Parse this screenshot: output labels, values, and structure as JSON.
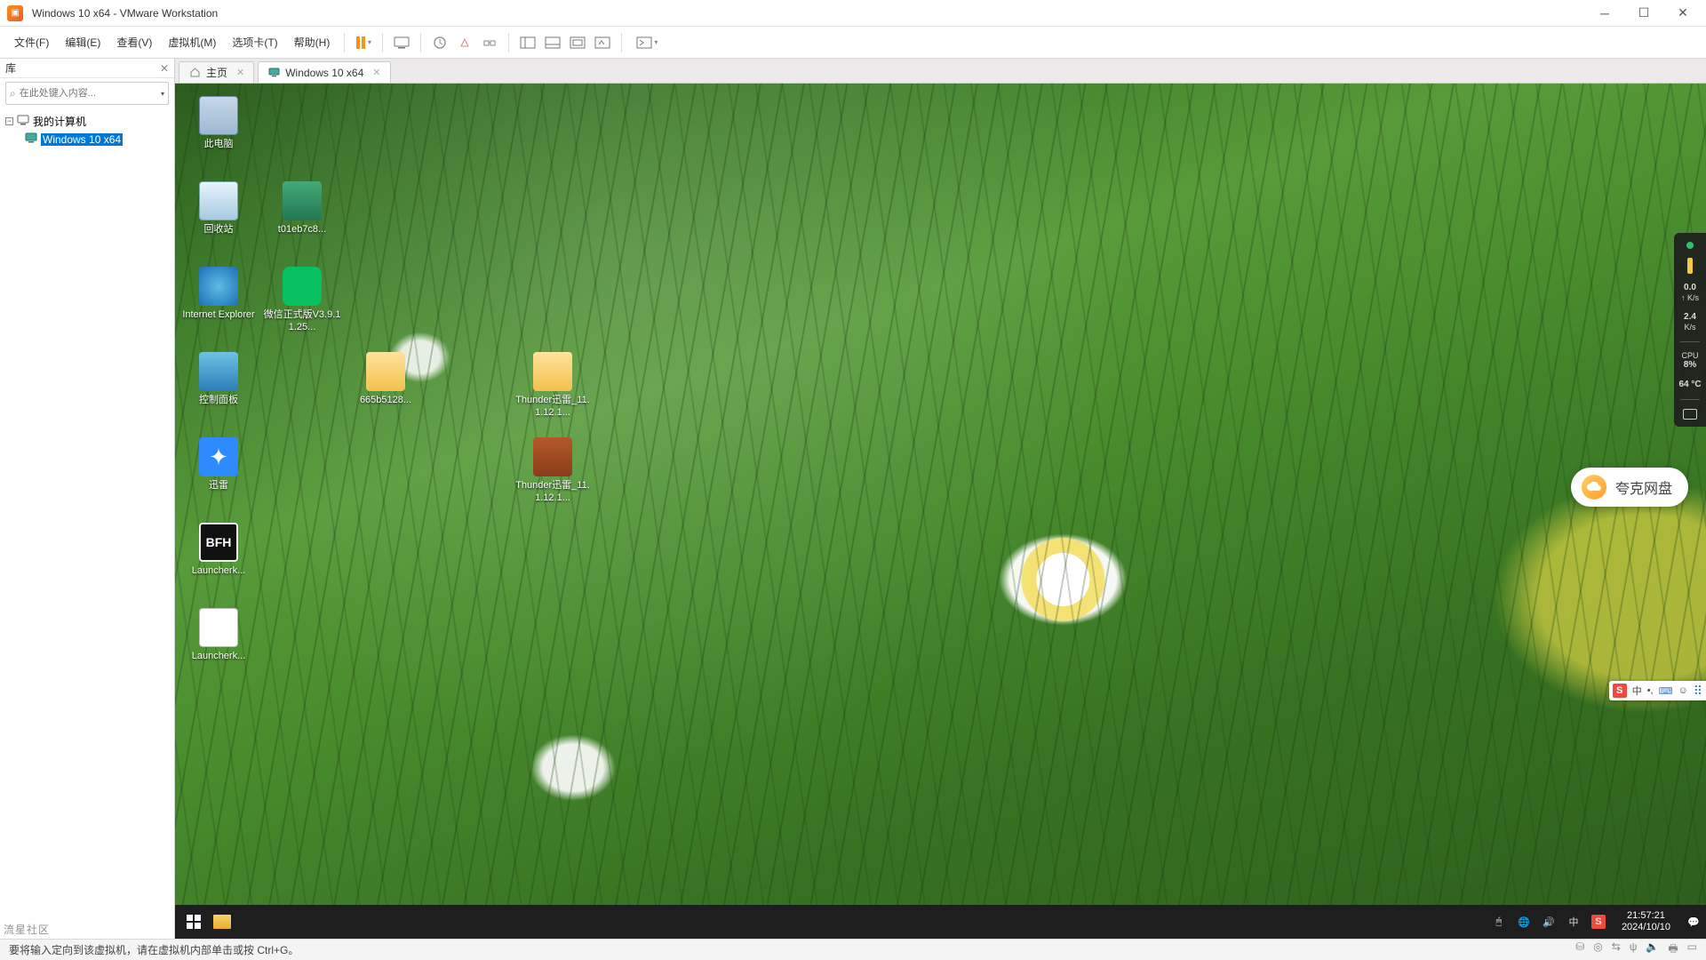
{
  "window": {
    "title": "Windows 10 x64 - VMware Workstation"
  },
  "menu": {
    "file": "文件(F)",
    "edit": "编辑(E)",
    "view": "查看(V)",
    "vm": "虚拟机(M)",
    "tabs": "选项卡(T)",
    "help": "帮助(H)"
  },
  "library": {
    "title": "库",
    "search_placeholder": "在此处键入内容...",
    "root": "我的计算机",
    "vm": "Windows 10 x64"
  },
  "tabs": {
    "home": "主页",
    "vm": "Windows 10 x64"
  },
  "desktop": {
    "this_pc": "此电脑",
    "recycle": "回收站",
    "thumb": "t01eb7c8...",
    "ie": "Internet Explorer",
    "wechat": "微信正式版V3.9.11.25...",
    "ctrl_panel": "控制面板",
    "folder665": "665b5128...",
    "thunder_inst": "Thunder迅雷_11.1.12.1...",
    "xunlei": "迅雷",
    "thunder_rar": "Thunder迅雷_11.1.12.1...",
    "bfh": "Launcherk...",
    "launcherk": "Launcherk..."
  },
  "quark": {
    "label": "夸克网盘"
  },
  "perf": {
    "up": "0.0",
    "up_unit": "↑ K/s",
    "down": "2.4",
    "down_unit": "K/s",
    "cpu_label": "CPU",
    "cpu": "8%",
    "temp": "64 °C"
  },
  "ime": {
    "zhong": "中"
  },
  "taskbar": {
    "lang": "中",
    "time": "21:57:21",
    "date": "2024/10/10"
  },
  "statusbar": {
    "hint": "要将输入定向到该虚拟机，请在虚拟机内部单击或按 Ctrl+G。"
  },
  "watermark": "流星社区"
}
